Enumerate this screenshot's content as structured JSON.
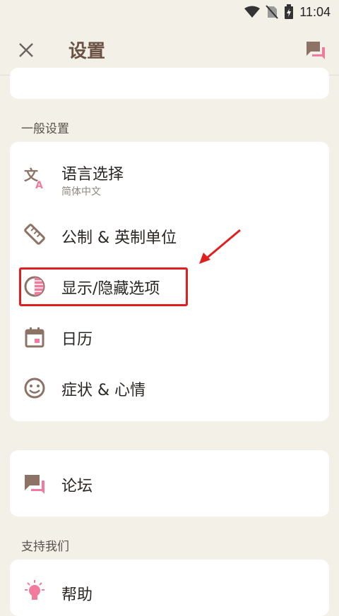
{
  "status": {
    "time": "11:04"
  },
  "appbar": {
    "title": "设置"
  },
  "general": {
    "header": "一般设置",
    "items": [
      {
        "label": "语言选择",
        "sub": "简体中文",
        "icon": "translate-icon"
      },
      {
        "label": "公制 & 英制单位",
        "icon": "ruler-icon"
      },
      {
        "label": "显示/隐藏选项",
        "icon": "half-circle-icon"
      },
      {
        "label": "日历",
        "icon": "calendar-icon"
      },
      {
        "label": "症状 & 心情",
        "icon": "smiley-icon"
      }
    ]
  },
  "forum": {
    "label": "论坛"
  },
  "support": {
    "header": "支持我们",
    "help_label": "帮助"
  },
  "colors": {
    "accent": "#f27a9c",
    "icon_brown": "#8d7266",
    "title_brown": "#6b5244",
    "annotation_red": "#e01e1e"
  }
}
